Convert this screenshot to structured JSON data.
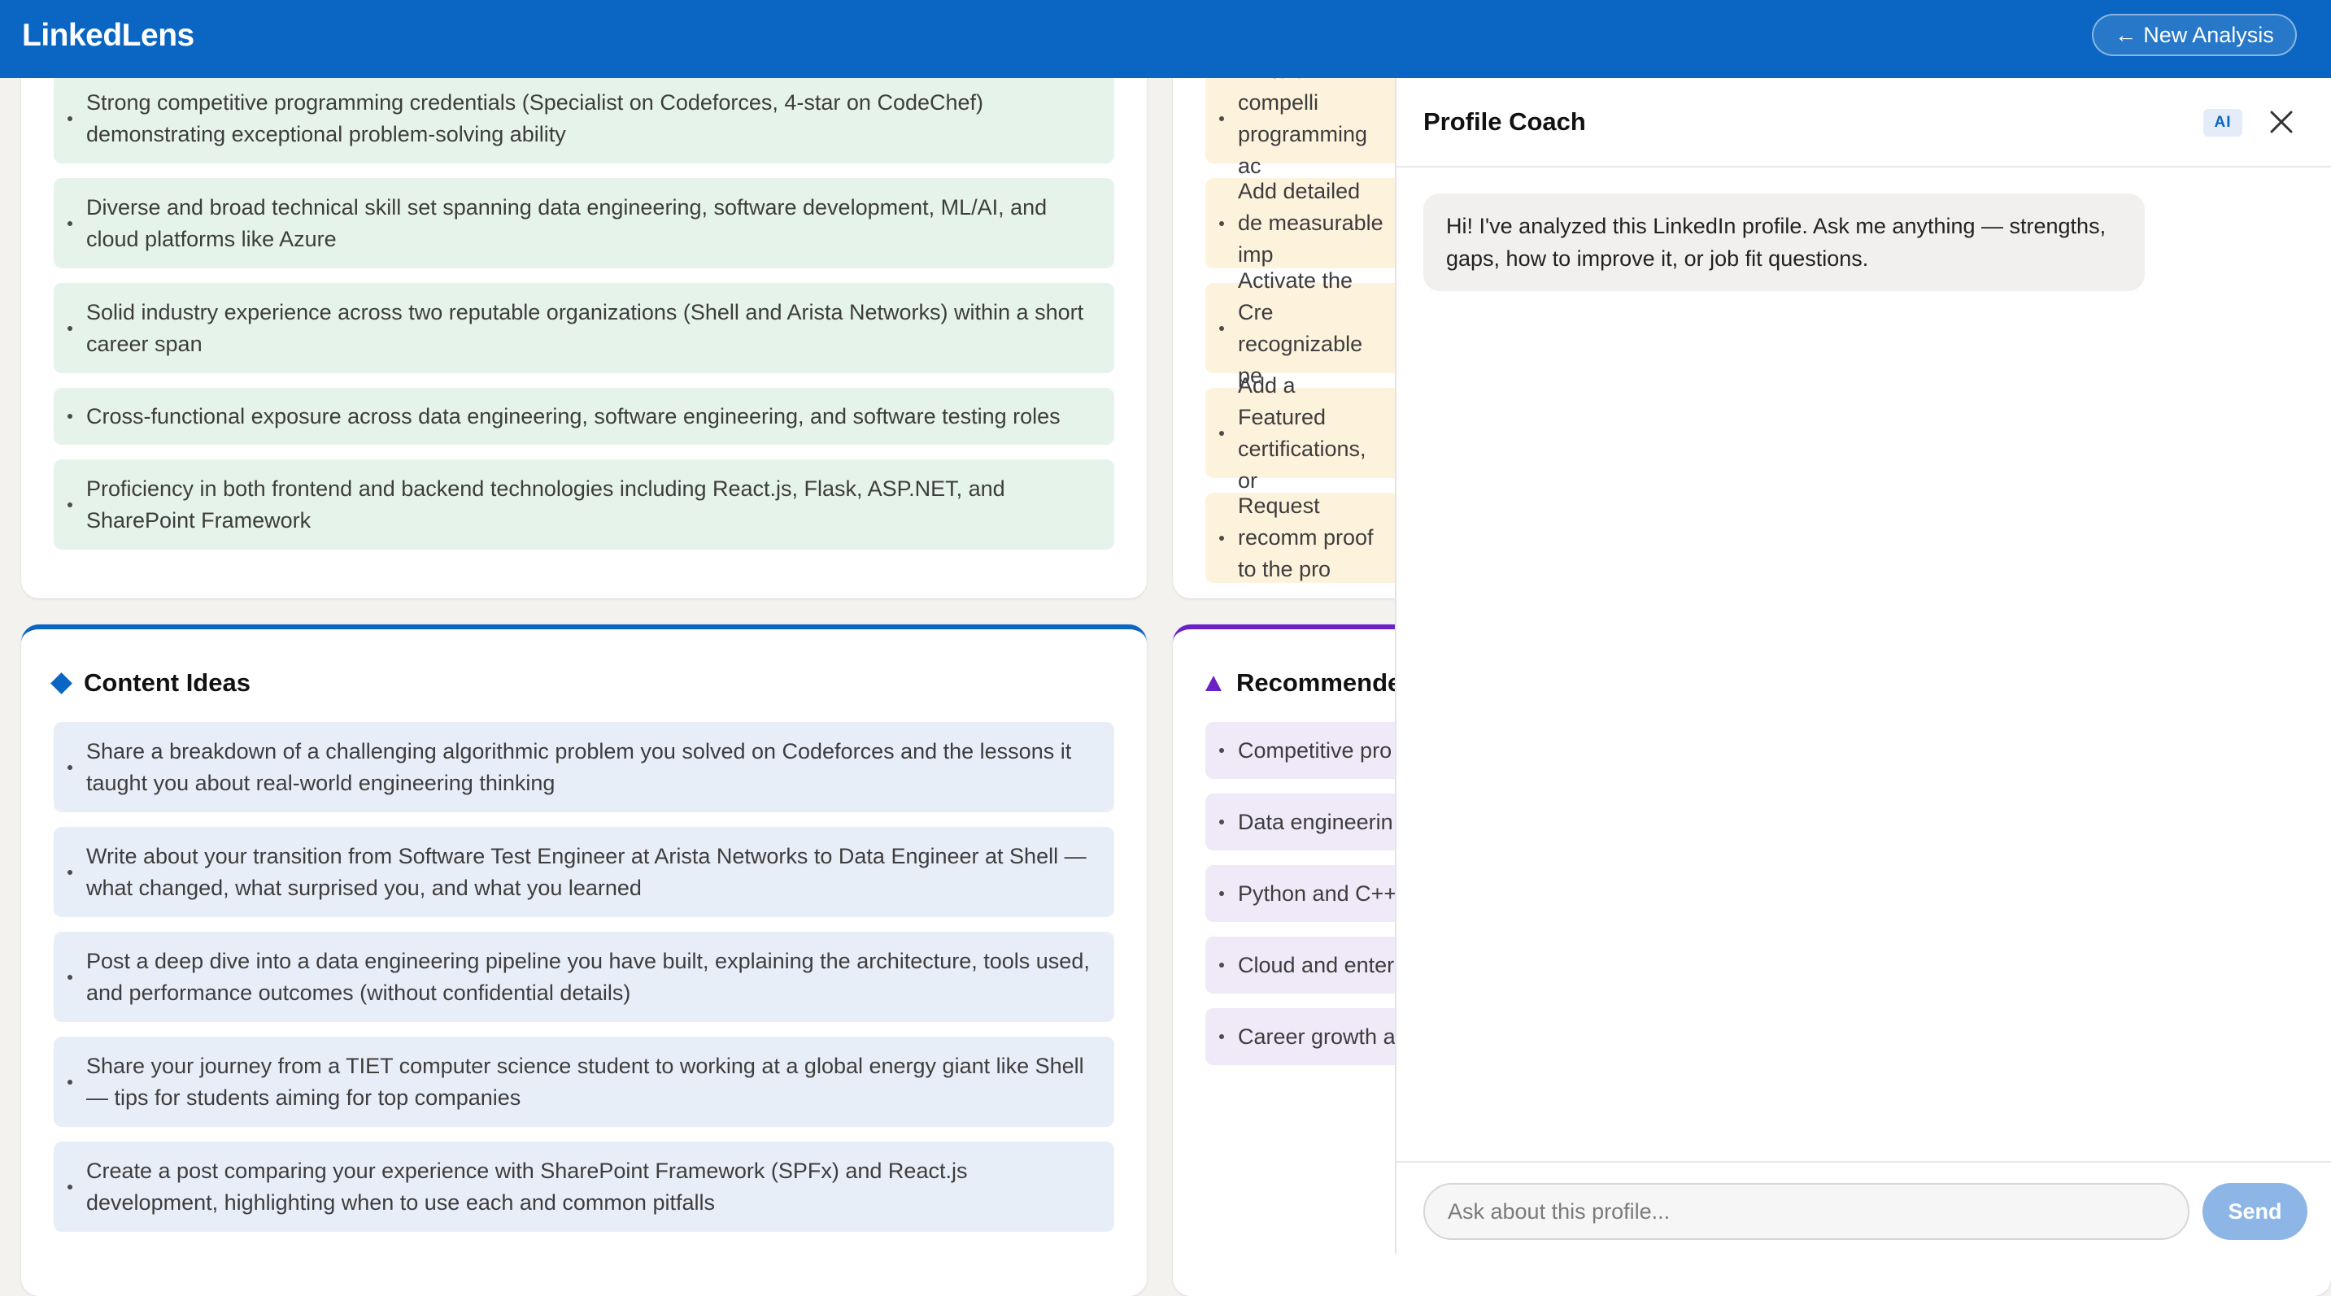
{
  "header": {
    "logo": "LinkedLens",
    "new_analysis_label": "New Analysis",
    "arrow_icon": "arrow-left-icon"
  },
  "strengths": {
    "items": [
      "Strong competitive programming credentials (Specialist on Codeforces, 4-star on CodeChef) demonstrating exceptional problem-solving ability",
      "Diverse and broad technical skill set spanning data engineering, software development, ML/AI, and cloud platforms like Azure",
      "Solid industry experience across two reputable organizations (Shell and Arista Networks) within a short career span",
      "Cross-functional exposure across data engineering, software engineering, and software testing roles",
      "Proficiency in both frontend and backend technologies including React.js, Flask, ASP.NET, and SharePoint Framework"
    ]
  },
  "improvements": {
    "items": [
      "Write a compelli programming ac",
      "Add detailed de measurable imp",
      "Activate the Cre recognizable pe",
      "Add a Featured certifications, or",
      "Request recomm proof to the pro"
    ]
  },
  "content_ideas": {
    "title": "Content Ideas",
    "icon": "diamond-icon",
    "items": [
      "Share a breakdown of a challenging algorithmic problem you solved on Codeforces and the lessons it taught you about real-world engineering thinking",
      "Write about your transition from Software Test Engineer at Arista Networks to Data Engineer at Shell — what changed, what surprised you, and what you learned",
      "Post a deep dive into a data engineering pipeline you have built, explaining the architecture, tools used, and performance outcomes (without confidential details)",
      "Share your journey from a TIET computer science student to working at a global energy giant like Shell — tips for students aiming for top companies",
      "Create a post comparing your experience with SharePoint Framework (SPFx) and React.js development, highlighting when to use each and common pitfalls"
    ]
  },
  "recommended": {
    "title": "Recommende",
    "icon": "triangle-icon",
    "items": [
      "Competitive pro",
      "Data engineerin",
      "Python and C++",
      "Cloud and enter",
      "Career growth a"
    ]
  },
  "coach": {
    "title": "Profile Coach",
    "ai_badge": "AI",
    "greeting": "Hi! I've analyzed this LinkedIn profile. Ask me anything — strengths, gaps, how to improve it, or job fit questions.",
    "input_placeholder": "Ask about this profile...",
    "send_label": "Send"
  },
  "colors": {
    "brand_blue": "#0a66c2",
    "purple_accent": "#6b21c8",
    "strength_bg": "#e6f3ea",
    "improvement_bg": "#fdf2dc",
    "idea_bg": "#e8eef8",
    "recommend_bg": "#efe9f8"
  }
}
